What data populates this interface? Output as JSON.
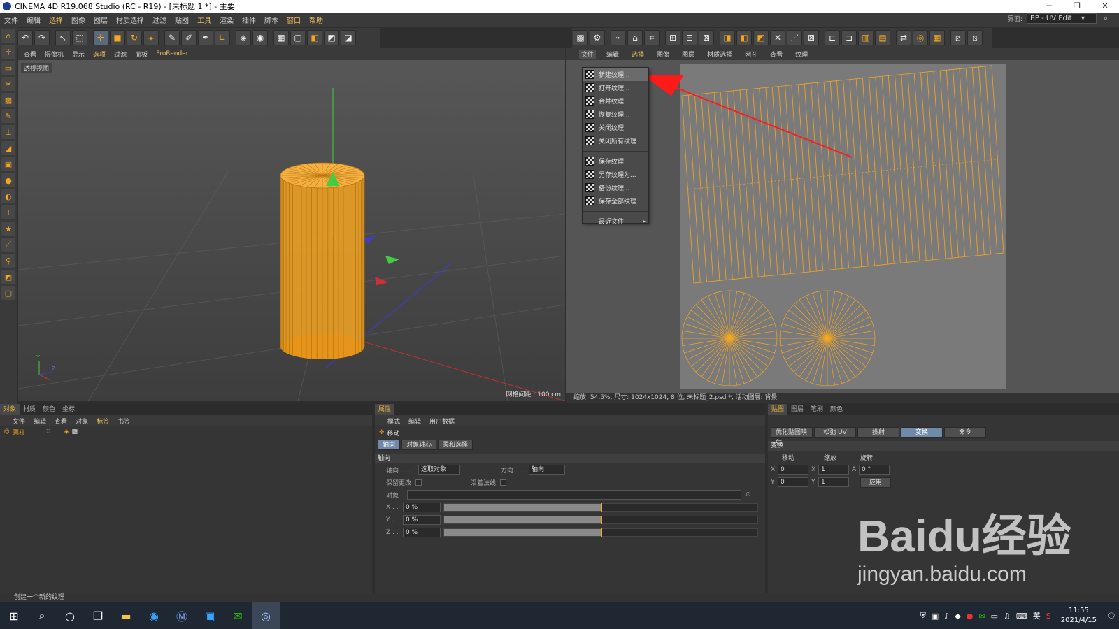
{
  "window": {
    "title": "CINEMA 4D R19.068 Studio (RC - R19) - [未标题 1 *] - 主要"
  },
  "menubar": {
    "items": [
      "文件",
      "编辑",
      "选择",
      "图像",
      "图层",
      "材质选择",
      "过滤",
      "贴图",
      "工具",
      "渲染",
      "插件",
      "脚本",
      "窗口",
      "帮助"
    ]
  },
  "interface": {
    "label": "界面:",
    "value": "BP - UV Edit"
  },
  "viewport": {
    "menu": [
      "查看",
      "摄像机",
      "显示",
      "选项",
      "过滤",
      "面板",
      "ProRender"
    ],
    "label": "透视视图",
    "grid_info": "网格间距 : 100 cm"
  },
  "uv_editor": {
    "menu": [
      "文件",
      "编辑",
      "选择",
      "图像",
      "图层",
      "材质选择",
      "网孔",
      "查看",
      "纹理"
    ],
    "status": "缩放: 54.5%, 尺寸: 1024x1024, 8 位, 未标题_2.psd *, 活动图层: 背景"
  },
  "file_menu": {
    "items": [
      {
        "label": "新建纹理..."
      },
      {
        "label": "打开纹理..."
      },
      {
        "label": "合并纹理..."
      },
      {
        "label": "恢复纹理..."
      },
      {
        "label": "关闭纹理"
      },
      {
        "label": "关闭所有纹理"
      },
      {
        "label": "保存纹理"
      },
      {
        "label": "另存纹理为..."
      },
      {
        "label": "备份纹理..."
      },
      {
        "label": "保存全部纹理"
      },
      {
        "label": "最近文件"
      }
    ]
  },
  "object_panel": {
    "tabs": [
      "对象",
      "材质",
      "颜色",
      "坐标"
    ],
    "menu": [
      "文件",
      "编辑",
      "查看",
      "对象",
      "标签",
      "书签"
    ],
    "object_name": "圆柱"
  },
  "attributes_panel": {
    "tab": "属性",
    "menu": [
      "模式",
      "编辑",
      "用户数据"
    ],
    "tool": "移动",
    "subtabs": [
      "轴向",
      "对象轴心",
      "柔和选择"
    ],
    "section": "轴向",
    "axis_label": "轴向 . . .",
    "axis_value": "选取对象",
    "direction_label": "方向 . . .",
    "direction_value": "轴向",
    "keep_changes": "保留更改",
    "along_normals": "沿着法线",
    "object_label": "对象",
    "x_label": "X . .",
    "x_value": "0 %",
    "y_label": "Y . .",
    "y_value": "0 %",
    "z_label": "Z . .",
    "z_value": "0 %"
  },
  "uv_panel": {
    "tabs": [
      "贴图",
      "图层",
      "笔刷",
      "颜色"
    ],
    "buttons": [
      "优化贴图映射",
      "松弛 UV",
      "投射",
      "变换",
      "命令"
    ],
    "section": "变换",
    "move": "移动",
    "scale": "缩放",
    "rotate": "旋转",
    "x": "X",
    "y": "Y",
    "a": "A",
    "move_x": "0",
    "move_y": "0",
    "scale_x": "1",
    "scale_y": "1",
    "rotate_a": "0 °",
    "apply": "应用"
  },
  "statusbar": {
    "text": "创建一个新的纹理"
  },
  "taskbar": {
    "time": "11:55",
    "date": "2021/4/15",
    "lang": "英"
  },
  "watermark": {
    "brand": "Baidu经验",
    "url": "jingyan.baidu.com"
  },
  "colors": {
    "accent": "#f4a623",
    "arrow": "#ff1a1a",
    "mesh": "#f4a623"
  }
}
